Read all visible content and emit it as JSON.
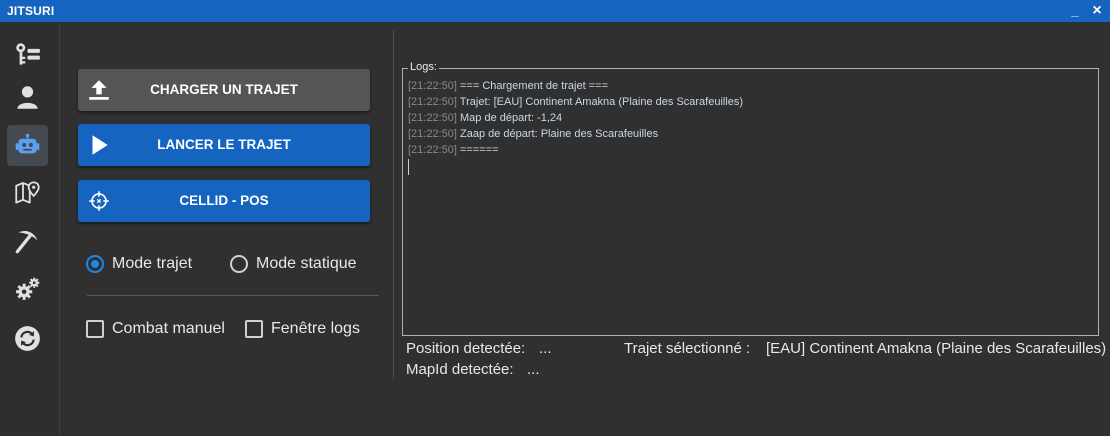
{
  "window": {
    "title": "JITSURI",
    "minimize": "_",
    "close": "×"
  },
  "sidebar": {
    "items": [
      {
        "icon": "key-list-icon",
        "active": false
      },
      {
        "icon": "user-icon",
        "active": false
      },
      {
        "icon": "robot-icon",
        "active": true
      },
      {
        "icon": "map-pin-icon",
        "active": false
      },
      {
        "icon": "pickaxe-icon",
        "active": false
      },
      {
        "icon": "gears-icon",
        "active": false
      },
      {
        "icon": "sync-icon",
        "active": false
      }
    ]
  },
  "actions": {
    "load_label": "CHARGER UN TRAJET",
    "start_label": "LANCER LE TRAJET",
    "cellid_label": "CELLID - POS"
  },
  "modes": {
    "trajet_label": "Mode trajet",
    "statique_label": "Mode statique",
    "selected": "trajet"
  },
  "options": {
    "combat_label": "Combat manuel",
    "combat_checked": false,
    "logs_window_label": "Fenêtre logs",
    "logs_window_checked": false
  },
  "logs": {
    "legend": "Logs:",
    "lines": [
      {
        "time": "[21:22:50]",
        "text": "=== Chargement de trajet ==="
      },
      {
        "time": "[21:22:50]",
        "text": "Trajet: [EAU] Continent Amakna (Plaine des Scarafeuilles)"
      },
      {
        "time": "[21:22:50]",
        "text": "Map de départ: -1,24"
      },
      {
        "time": "[21:22:50]",
        "text": "Zaap de départ: Plaine des Scarafeuilles"
      },
      {
        "time": "[21:22:50]",
        "text": "======"
      }
    ]
  },
  "status": {
    "position_label": "Position detectée:",
    "position_value": "...",
    "mapid_label": "MapId detectée:",
    "mapid_value": "...",
    "trajet_label": "Trajet sélectionné :",
    "trajet_value": "[EAU] Continent Amakna (Plaine des Scarafeuilles)"
  },
  "colors": {
    "accent": "#1565c0",
    "background": "#303030",
    "sidebar": "#2e2e2e",
    "grey_button": "#555555"
  }
}
